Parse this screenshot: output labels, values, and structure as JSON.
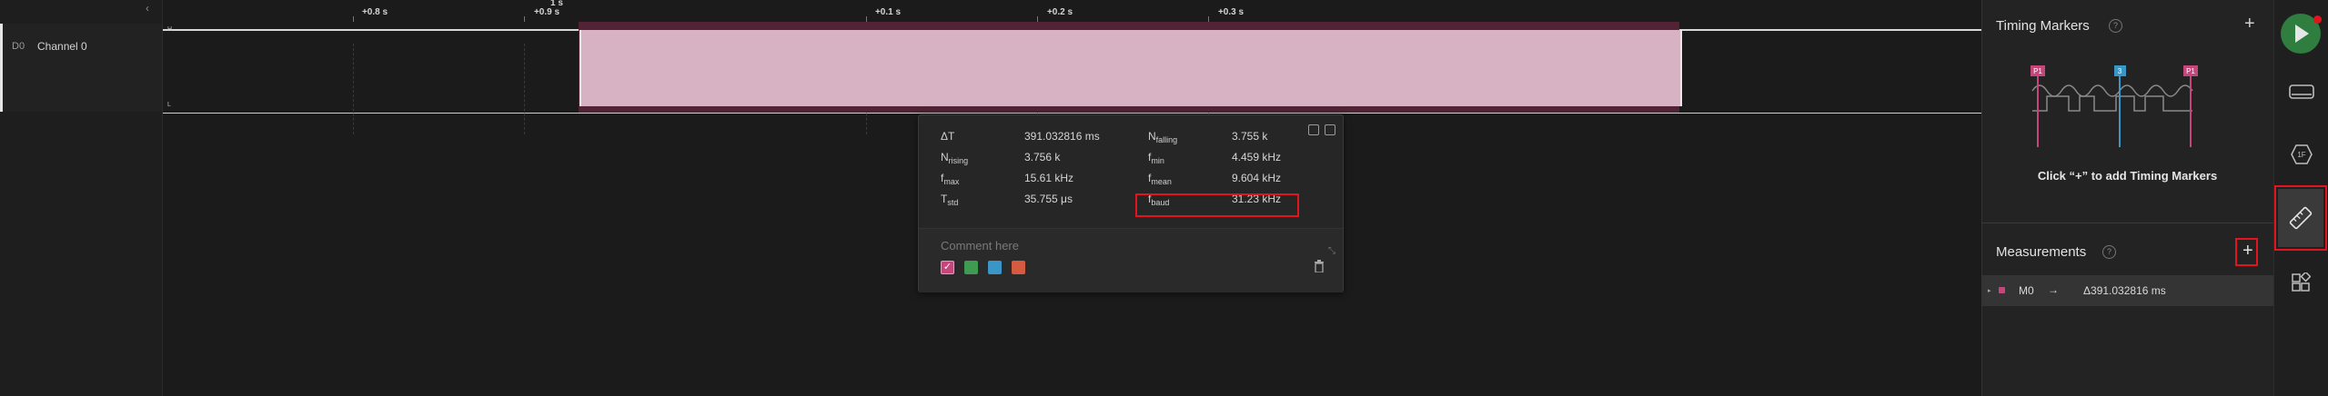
{
  "channel": {
    "id": "D0",
    "name": "Channel 0",
    "high_marker": "H",
    "low_marker": "L"
  },
  "timeline": {
    "ticks": [
      "+0.8 s",
      "+0.9 s",
      "1 s",
      "+0.1 s",
      "+0.2 s",
      "+0.3 s"
    ]
  },
  "measurement_popup": {
    "rows": [
      {
        "l_sym": "ΔT",
        "l_sub": "",
        "l_val": "391.032816 ms",
        "r_sym": "N",
        "r_sub": "falling",
        "r_val": "3.755 k"
      },
      {
        "l_sym": "N",
        "l_sub": "rising",
        "l_val": "3.756 k",
        "r_sym": "f",
        "r_sub": "min",
        "r_val": "4.459 kHz"
      },
      {
        "l_sym": "f",
        "l_sub": "max",
        "l_val": "15.61 kHz",
        "r_sym": "f",
        "r_sub": "mean",
        "r_val": "9.604 kHz"
      },
      {
        "l_sym": "T",
        "l_sub": "std",
        "l_val": "35.755 μs",
        "r_sym": "f",
        "r_sub": "baud",
        "r_val": "31.23 kHz"
      }
    ],
    "comment_placeholder": "Comment here",
    "colors": [
      "#c4467b",
      "#3f9a52",
      "#3b96c8",
      "#d65a40"
    ]
  },
  "timing_markers": {
    "title": "Timing Markers",
    "help": "?",
    "add": "+",
    "illustration_labels": [
      "P1",
      "3",
      "P1"
    ],
    "hint": "Click “+” to add Timing Markers"
  },
  "measurements": {
    "title": "Measurements",
    "help": "?",
    "add": "+",
    "items": [
      {
        "name": "M0",
        "arrow": "→",
        "value": "Δ391.032816 ms"
      }
    ]
  },
  "toolbar": {
    "icons": [
      "play-icon",
      "device-icon",
      "analyzer-icon",
      "ruler-icon",
      "extensions-icon"
    ]
  },
  "accent_colors": {
    "highlight_box": "#e2141e",
    "selection": "#d7b2c2",
    "marker": "#c4467b"
  }
}
